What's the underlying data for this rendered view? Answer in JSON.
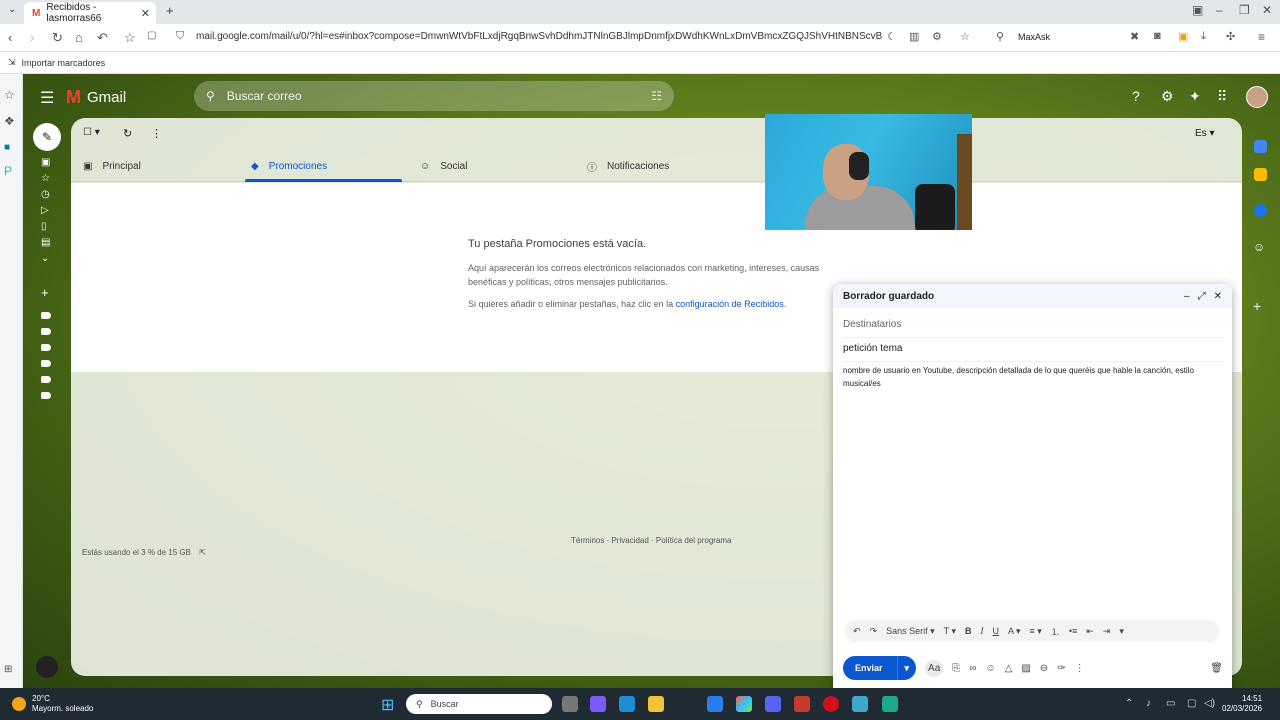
{
  "browser": {
    "tab_title": "Recibidos - lasmorras66",
    "url": "mail.google.com/mail/u/0/?hl=es#inbox?compose=DmwnWtVbFtLxdjRgqBnwSvhDdhmJTNlnGBJlmpDnmfjxDWdhKWnLxDmVBmcxZGQJShVHtNBNScvB",
    "search_engine": "MaxAsk",
    "bookmark_label": "Importar marcadores"
  },
  "gmail": {
    "logo_text": "Gmail",
    "search_placeholder": "Buscar correo",
    "density_label": "Es",
    "tabs": [
      {
        "label": "Principal"
      },
      {
        "label": "Promociones"
      },
      {
        "label": "Social"
      },
      {
        "label": "Notificaciones"
      }
    ],
    "empty": {
      "heading": "Tu pestaña Promociones está vacía.",
      "line1": "Aquí aparecerán los correos electrónicos relacionados con marketing, intereses, causas benéficas y políticas, otros mensajes publicitarios.",
      "line2_prefix": "Si quieres añadir o eliminar pestañas, haz clic en la",
      "line2_link": "configuración de Recibidos",
      "line2_suffix": "."
    },
    "storage": "Estás usando el 3 % de 15 GB",
    "footer": "Términos · Privacidad · Política del programa"
  },
  "compose": {
    "title": "Borrador guardado",
    "to_placeholder": "Destinatarios",
    "subject": "petición tema",
    "body": "nombre de usuario en Youtube, descripción detallada de lo que queréis que hable la canción, estilo musical/es",
    "font": "Sans Serif",
    "send_label": "Enviar",
    "aa_label": "Aa"
  },
  "taskbar": {
    "temp": "20°C",
    "weather": "Mayorm. soleado",
    "search": "Buscar",
    "time": "14:51",
    "date": "02/03/2026"
  },
  "colors": {
    "accent": "#0b57d0",
    "gmail_red": "#ea4335",
    "taskbar": "#1f2a33"
  }
}
